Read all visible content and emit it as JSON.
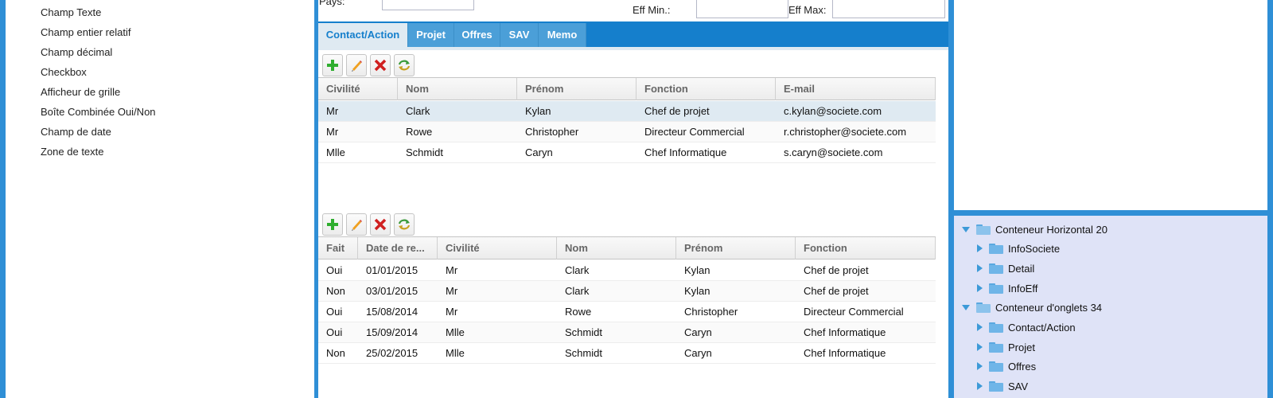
{
  "palette": {
    "items": [
      "Champ Texte",
      "Champ entier relatif",
      "Champ décimal",
      "Checkbox",
      "Afficheur de grille",
      "Boîte Combinée Oui/Non",
      "Champ de date",
      "Zone de texte"
    ]
  },
  "form": {
    "pays_label": "Pays:",
    "eff_min_label": "Eff Min.:",
    "eff_max_label": "Eff Max:",
    "pays_value": "",
    "eff_min_value": "",
    "eff_max_value": ""
  },
  "tabs": [
    {
      "label": "Contact/Action",
      "active": true
    },
    {
      "label": "Projet",
      "active": false
    },
    {
      "label": "Offres",
      "active": false
    },
    {
      "label": "SAV",
      "active": false
    },
    {
      "label": "Memo",
      "active": false
    }
  ],
  "toolbar_icons": [
    "add-icon",
    "edit-icon",
    "delete-icon",
    "refresh-icon"
  ],
  "contacts_grid": {
    "columns": [
      "Civilité",
      "Nom",
      "Prénom",
      "Fonction",
      "E-mail"
    ],
    "rows": [
      [
        "Mr",
        "Clark",
        "Kylan",
        "Chef de projet",
        "c.kylan@societe.com"
      ],
      [
        "Mr",
        "Rowe",
        "Christopher",
        "Directeur Commercial",
        "r.christopher@societe.com"
      ],
      [
        "Mlle",
        "Schmidt",
        "Caryn",
        "Chef Informatique",
        "s.caryn@societe.com"
      ]
    ]
  },
  "actions_grid": {
    "columns": [
      "Fait",
      "Date de re...",
      "Civilité",
      "Nom",
      "Prénom",
      "Fonction"
    ],
    "rows": [
      [
        "Oui",
        "01/01/2015",
        "Mr",
        "Clark",
        "Kylan",
        "Chef de projet"
      ],
      [
        "Non",
        "03/01/2015",
        "Mr",
        "Clark",
        "Kylan",
        "Chef de projet"
      ],
      [
        "Oui",
        "15/08/2014",
        "Mr",
        "Rowe",
        "Christopher",
        "Directeur Commercial"
      ],
      [
        "Oui",
        "15/09/2014",
        "Mlle",
        "Schmidt",
        "Caryn",
        "Chef Informatique"
      ],
      [
        "Non",
        "25/02/2015",
        "Mlle",
        "Schmidt",
        "Caryn",
        "Chef Informatique"
      ]
    ]
  },
  "tree": {
    "nodes": [
      {
        "label": "Conteneur Horizontal 20",
        "level": 0,
        "expanded": true
      },
      {
        "label": "InfoSociete",
        "level": 1,
        "expanded": false
      },
      {
        "label": "Detail",
        "level": 1,
        "expanded": false
      },
      {
        "label": "InfoEff",
        "level": 1,
        "expanded": false
      },
      {
        "label": "Conteneur d'onglets 34",
        "level": 0,
        "expanded": true
      },
      {
        "label": "Contact/Action",
        "level": 1,
        "expanded": false
      },
      {
        "label": "Projet",
        "level": 1,
        "expanded": false
      },
      {
        "label": "Offres",
        "level": 1,
        "expanded": false
      },
      {
        "label": "SAV",
        "level": 1,
        "expanded": false
      }
    ]
  },
  "colors": {
    "accent": "#157fcc",
    "border_blue": "#2f8fd6",
    "tree_bg": "#dfe3f7",
    "selected_row": "#dfeaf2"
  }
}
